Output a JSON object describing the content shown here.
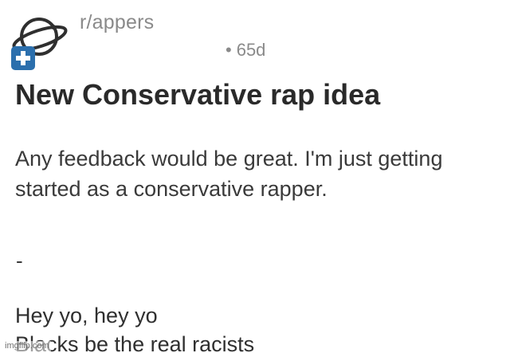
{
  "post": {
    "subreddit": "r/appers",
    "meta_separator": "•",
    "age": "65d",
    "title": "New Conservative rap idea",
    "body": [
      "Any feedback would be great. I'm just getting",
      "started as a conservative rapper."
    ],
    "separator": "-",
    "lyrics": [
      "Hey yo, hey yo",
      "Blacks be the real racists"
    ]
  },
  "watermark": {
    "text": "imgflip.com"
  },
  "icons": {
    "avatar": "subreddit-planet-icon",
    "badge": "plus-badge-icon"
  },
  "colors": {
    "text": "#2f2f2f",
    "muted": "#8a8a8a",
    "avatar_blue": "#2b6fad"
  }
}
